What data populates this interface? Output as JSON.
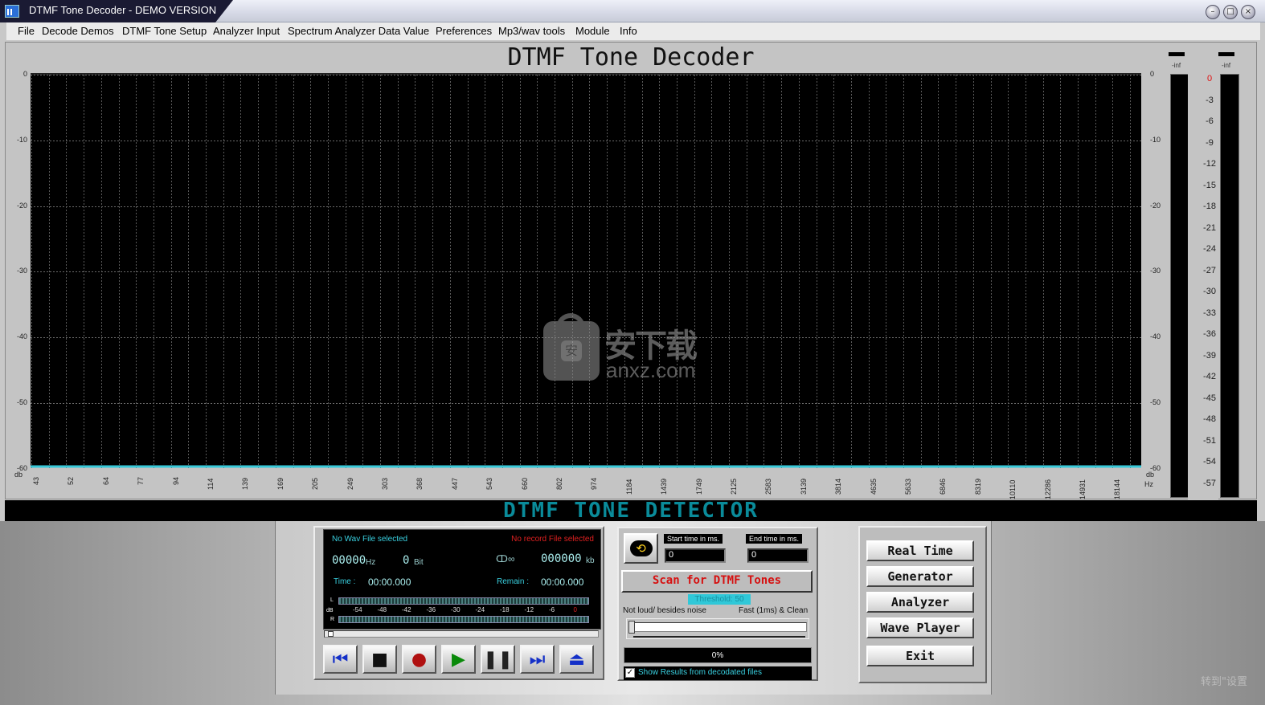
{
  "window": {
    "title": "DTMF Tone Decoder - DEMO VERSION"
  },
  "menu": [
    "File",
    "Decode Demos",
    "DTMF Tone Setup",
    "Analyzer Input",
    "Spectrum Analyzer Data Value",
    "Preferences",
    "Mp3/wav tools",
    "Module",
    "Info"
  ],
  "analyzer": {
    "title": "DTMF Tone Decoder",
    "y_unit": "db",
    "x_unit": "Hz",
    "y_ticks": [
      "0",
      "-10",
      "-20",
      "-30",
      "-40",
      "-50",
      "-60"
    ],
    "x_ticks": [
      "43",
      "52",
      "64",
      "77",
      "94",
      "114",
      "139",
      "169",
      "205",
      "249",
      "303",
      "368",
      "447",
      "543",
      "660",
      "802",
      "974",
      "1184",
      "1439",
      "1749",
      "2125",
      "2583",
      "3139",
      "3814",
      "4635",
      "5633",
      "6846",
      "8319",
      "10110",
      "12286",
      "14931",
      "18144"
    ]
  },
  "meters": {
    "left_value": "-inf",
    "right_value": "-inf",
    "scale": [
      "0",
      "-3",
      "-6",
      "-9",
      "-12",
      "-15",
      "-18",
      "-21",
      "-24",
      "-27",
      "-30",
      "-33",
      "-36",
      "-39",
      "-42",
      "-45",
      "-48",
      "-51",
      "-54",
      "-57"
    ],
    "scale_top_color": "#e01010"
  },
  "detector_label": "DTMF TONE DETECTOR",
  "player": {
    "wav_status": "No Wav File selected",
    "record_status": "No record File selected",
    "hz_digits": "00000",
    "hz_unit": "Hz",
    "bit_digits": "0",
    "bit_unit": "Bit",
    "kb_digits": "000000",
    "kb_unit": "kb",
    "time_label": "Time :",
    "time_value": "00:00.000",
    "remain_label": "Remain :",
    "remain_value": "00:00.000",
    "vu_scale": [
      "-54",
      "-48",
      "-42",
      "-36",
      "-30",
      "-24",
      "-18",
      "-12",
      "-6",
      "0"
    ],
    "vu_l": "L",
    "vu_db": "dB",
    "vu_r": "R"
  },
  "transport": [
    "skip-back",
    "stop",
    "record",
    "play",
    "pause",
    "skip-forward",
    "eject"
  ],
  "scan": {
    "start_label": "Start time in ms.",
    "start_value": "0",
    "end_label": "End time in ms.",
    "end_value": "0",
    "scan_button": "Scan for DTMF Tones",
    "threshold": "Threshold: 50",
    "slider_left_label": "Not loud/ besides noise",
    "slider_right_label": "Fast (1ms) & Clean",
    "progress": "0%",
    "show_results_label": "Show Results from decodated files",
    "show_results_checked": true
  },
  "modules": [
    "Real Time",
    "Generator",
    "Analyzer",
    "Wave Player",
    "Exit"
  ],
  "watermark": {
    "text1": "安下载",
    "text2": "anxz.com"
  },
  "corner_text": "转到\"设置"
}
